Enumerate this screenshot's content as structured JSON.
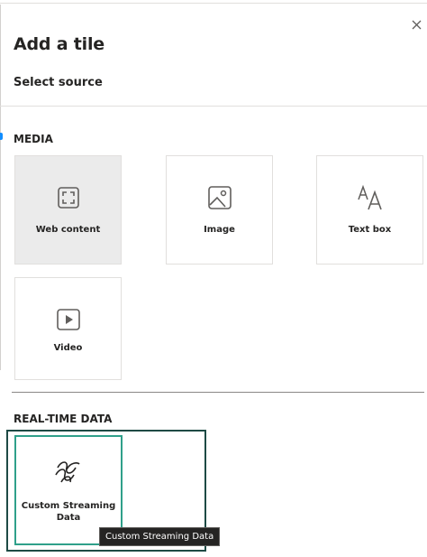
{
  "dialog": {
    "title": "Add a tile",
    "subtitle": "Select source"
  },
  "sections": {
    "media": "MEDIA",
    "realtime": "REAL-TIME DATA"
  },
  "tiles": {
    "web": {
      "label": "Web content",
      "icon": "web-content-icon",
      "selected": true
    },
    "image": {
      "label": "Image",
      "icon": "image-icon"
    },
    "text": {
      "label": "Text box",
      "icon": "text-box-icon"
    },
    "video": {
      "label": "Video",
      "icon": "video-icon"
    },
    "stream": {
      "label": "Custom Streaming Data",
      "icon": "streaming-icon",
      "focused": true
    }
  },
  "tooltip": "Custom Streaming Data",
  "colors": {
    "selected_tile_bg": "#ebebeb",
    "focus_border": "#2fa08a",
    "focus_outer": "#1e4a45",
    "tooltip_bg": "#252423"
  }
}
